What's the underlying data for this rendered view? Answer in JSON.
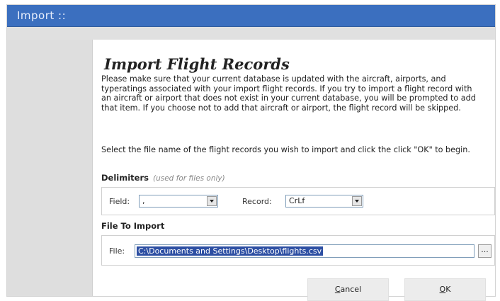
{
  "window": {
    "title": "Import ::"
  },
  "dialog": {
    "heading": "Import Flight Records",
    "description": "Please make sure that your current database is updated with the aircraft, airports, and typeratings associated with your import flight records. If you try to import a flight record with an aircraft or airport that does not exist in your current database, you will be prompted to add that item. If you choose not to add that aircraft or airport, the flight record will be skipped.",
    "instruction": "Select the file name of the flight records you wish to import and click the click \"OK\" to begin."
  },
  "delimiters": {
    "label": "Delimiters",
    "hint": "(used for files only)",
    "field_label": "Field:",
    "field_value": ",",
    "record_label": "Record:",
    "record_value": "CrLf"
  },
  "file_to_import": {
    "label": "File To Import",
    "file_label": "File:",
    "file_value": "C:\\Documents and Settings\\Desktop\\flights.csv",
    "browse_label": "..."
  },
  "buttons": {
    "cancel_first": "C",
    "cancel_rest": "ancel",
    "ok_first": "O",
    "ok_rest": "K"
  },
  "colors": {
    "titlebar": "#3b6fbf",
    "selection": "#2d4fa3"
  }
}
